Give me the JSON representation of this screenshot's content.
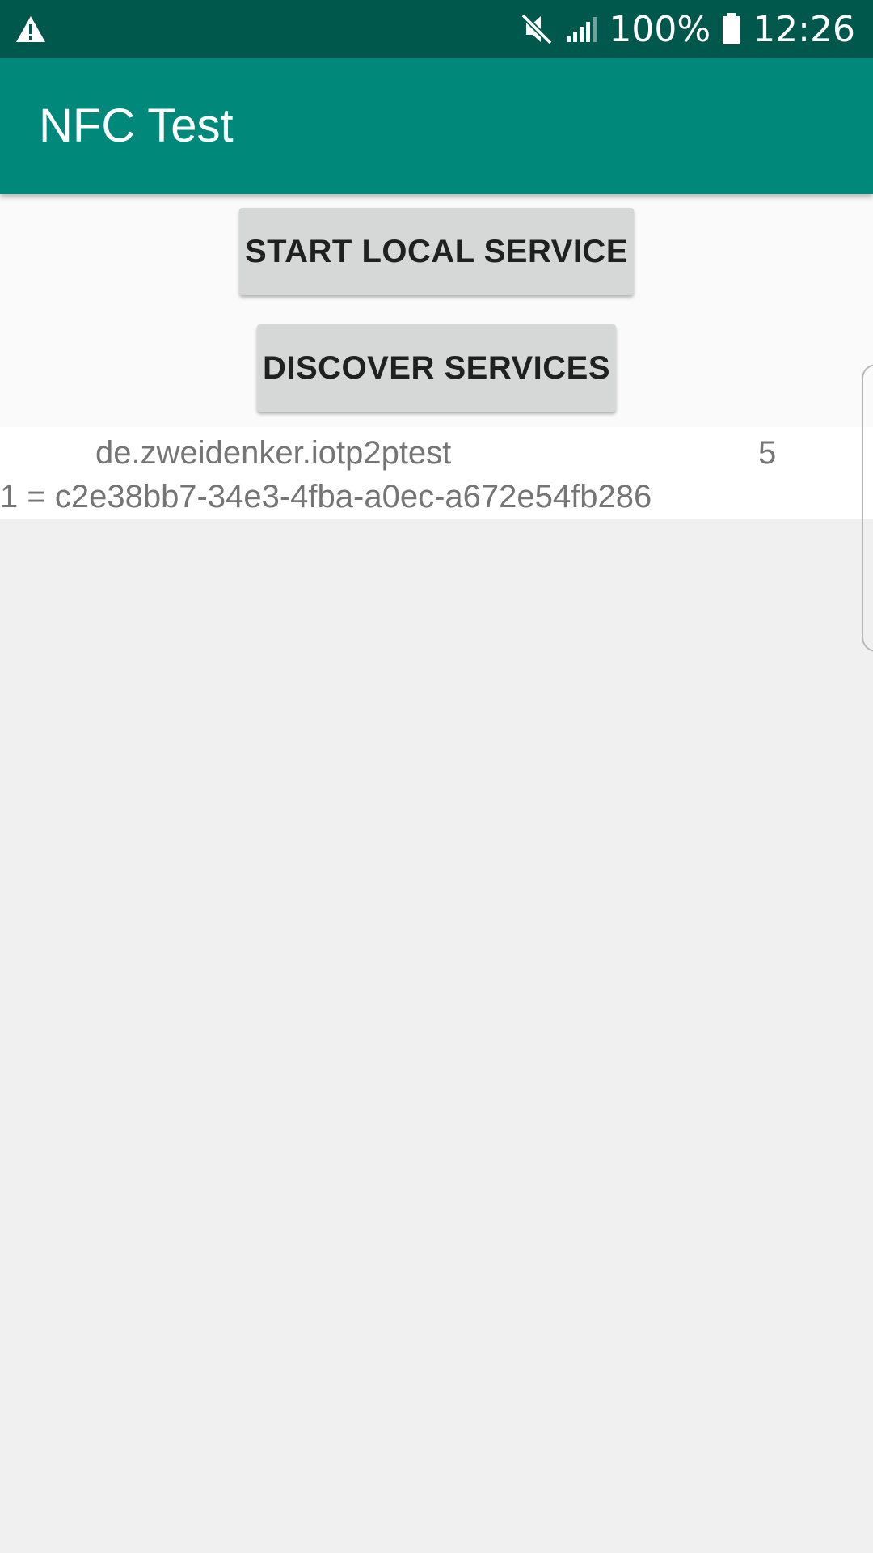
{
  "status_bar": {
    "warning_icon": "warning-triangle-icon",
    "mute_icon": "vibrate-mute-icon",
    "signal_icon": "cell-signal-icon",
    "battery_percent": "100%",
    "battery_icon": "battery-icon",
    "time": "12:26",
    "bg_color": "#00574b"
  },
  "app_bar": {
    "title": "NFC Test",
    "bg_color": "#00897b"
  },
  "buttons": {
    "start_label": "START LOCAL SERVICE",
    "discover_label": "DISCOVER SERVICES"
  },
  "services": [
    {
      "name": "de.zweidenker.iotp2ptest",
      "count": "5",
      "detail": "1 = c2e38bb7-34e3-4fba-a0ec-a672e54fb286"
    }
  ]
}
